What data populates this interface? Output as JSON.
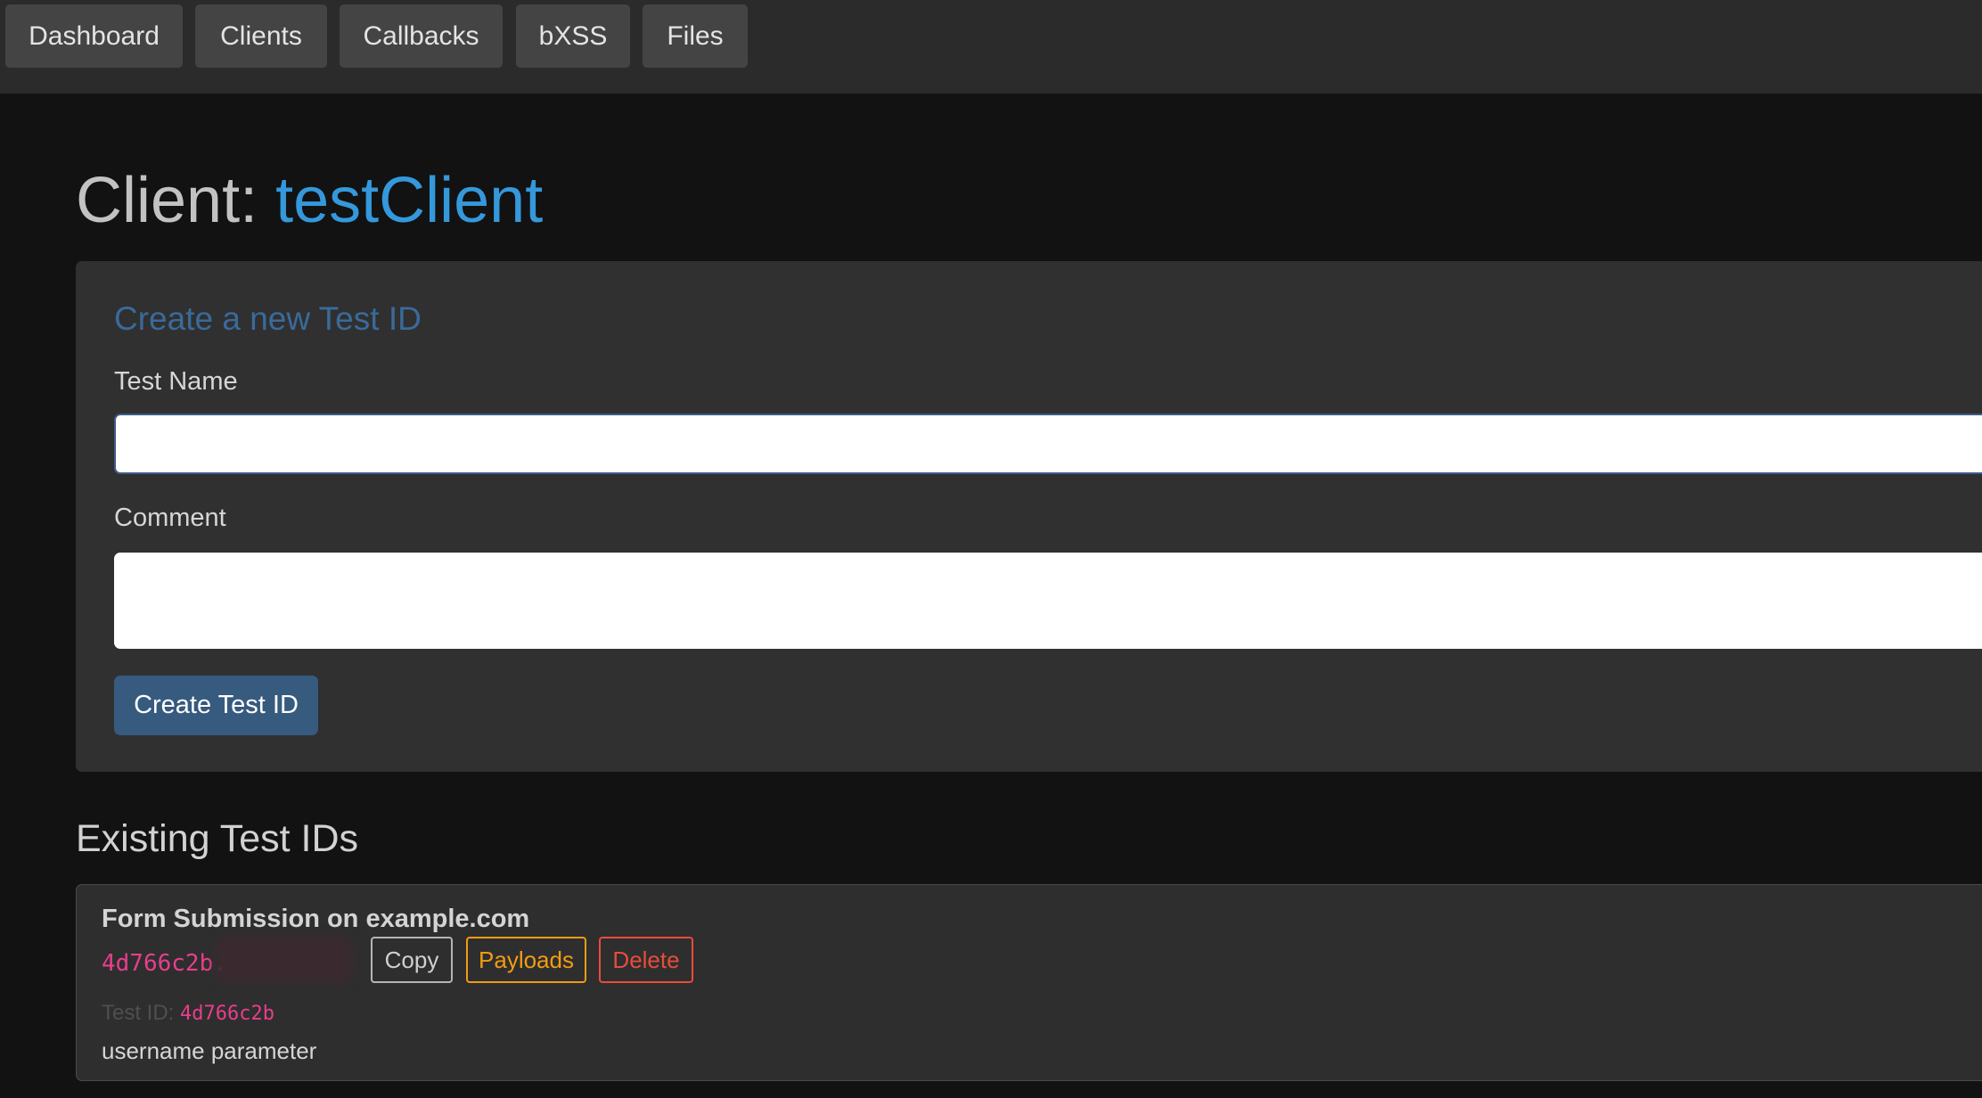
{
  "nav": {
    "items": [
      {
        "label": "Dashboard"
      },
      {
        "label": "Clients"
      },
      {
        "label": "Callbacks"
      },
      {
        "label": "bXSS"
      },
      {
        "label": "Files"
      }
    ]
  },
  "page": {
    "title_prefix": "Client: ",
    "client_name": "testClient"
  },
  "create_form": {
    "title": "Create a new Test ID",
    "test_name_label": "Test Name",
    "test_name_value": "",
    "comment_label": "Comment",
    "comment_value": "",
    "submit_label": "Create Test ID"
  },
  "existing": {
    "heading": "Existing Test IDs",
    "items": [
      {
        "name": "Form Submission on example.com",
        "domain_prefix": "4d766c2b.",
        "copy_label": "Copy",
        "payloads_label": "Payloads",
        "delete_label": "Delete",
        "test_id_label": "Test ID:",
        "test_id": "4d766c2b",
        "comment": "username parameter"
      }
    ]
  },
  "colors": {
    "accent": "#3498db",
    "card_title": "#3a6a9a",
    "primary_button": "#375a7f",
    "code": "#e83e8c",
    "warning": "#f39c12",
    "danger": "#e74c3c"
  }
}
